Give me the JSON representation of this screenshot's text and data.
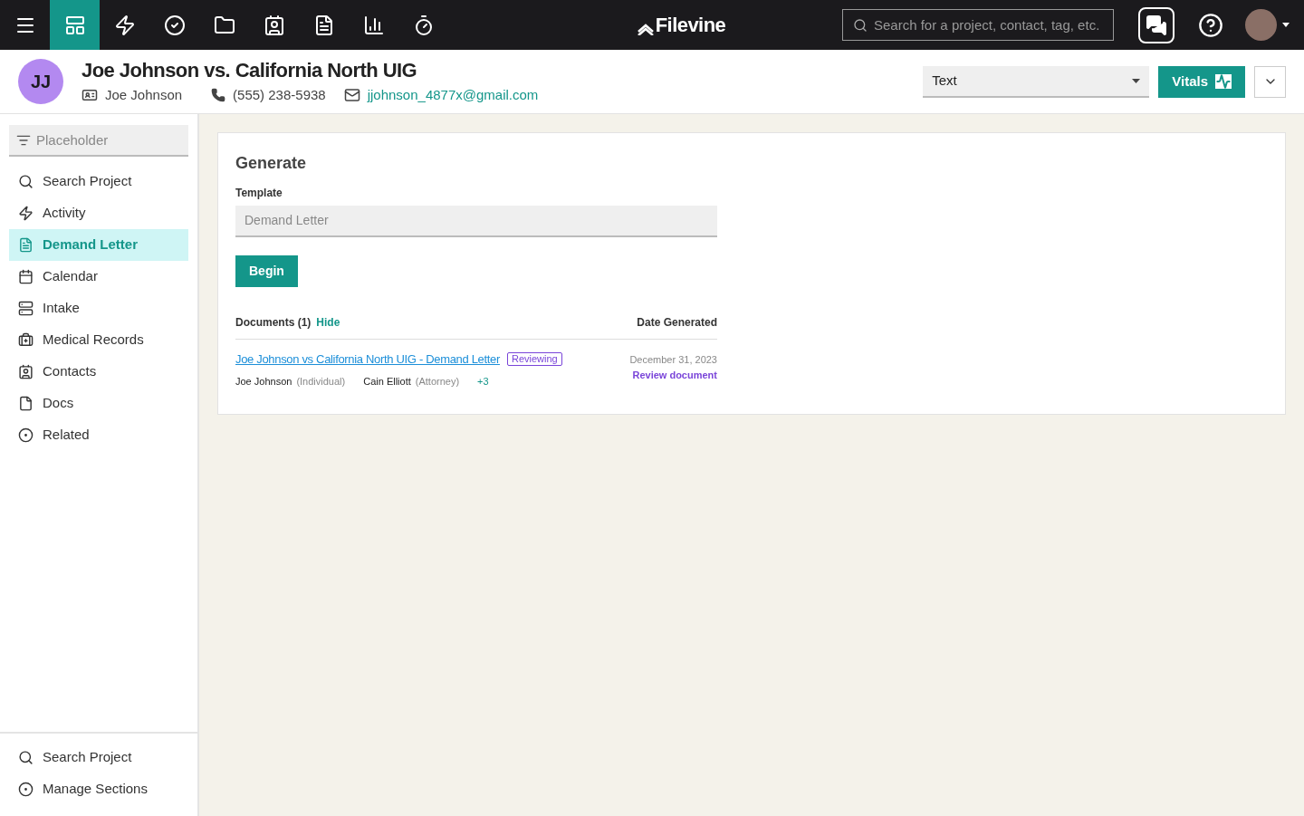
{
  "topbar": {
    "nav": [
      {
        "kind": "menu",
        "selected": false
      },
      {
        "kind": "dashboard",
        "selected": true
      },
      {
        "kind": "bolt",
        "selected": false
      },
      {
        "kind": "check",
        "selected": false
      },
      {
        "kind": "folder",
        "selected": false
      },
      {
        "kind": "contact",
        "selected": false
      },
      {
        "kind": "invoice",
        "selected": false
      },
      {
        "kind": "chart",
        "selected": false
      },
      {
        "kind": "timer",
        "selected": false
      }
    ],
    "logo": "Filevine",
    "search": {
      "placeholder": "Search for a project, contact, tag, etc."
    }
  },
  "header": {
    "initials": "JJ",
    "title": "Joe Johnson vs. California North UIG",
    "client": "Joe Johnson",
    "phone": "(555) 238-5938",
    "email": "jjohnson_4877x@gmail.com",
    "select": "Text",
    "vitals": "Vitals"
  },
  "sidebar": {
    "filter": {
      "placeholder": "Placeholder"
    },
    "items": [
      {
        "label": "Search Project",
        "kind": "search",
        "selected": false
      },
      {
        "label": "Activity",
        "kind": "bolt",
        "selected": false
      },
      {
        "label": "Demand Letter",
        "kind": "invoice",
        "selected": true
      },
      {
        "label": "Calendar",
        "kind": "calendar",
        "selected": false
      },
      {
        "label": "Intake",
        "kind": "intake",
        "selected": false
      },
      {
        "label": "Medical Records",
        "kind": "medical",
        "selected": false
      },
      {
        "label": "Contacts",
        "kind": "contact",
        "selected": false
      },
      {
        "label": "Docs",
        "kind": "doc",
        "selected": false
      },
      {
        "label": "Related",
        "kind": "related",
        "selected": false
      }
    ],
    "footer": [
      {
        "label": "Search Project",
        "kind": "search"
      },
      {
        "label": "Manage Sections",
        "kind": "related"
      }
    ]
  },
  "generate": {
    "title": "Generate",
    "template_label": "Template",
    "template_value": "Demand Letter",
    "begin": "Begin",
    "documents_label": "Documents (1)",
    "hide": "Hide",
    "date_header": "Date Generated",
    "documents": [
      {
        "title": "Joe Johnson vs California North UIG - Demand Letter",
        "status": "Reviewing",
        "date": "December 31, 2023",
        "action": "Review document",
        "people": [
          {
            "name": "Joe Johnson",
            "role": "(Individual)"
          },
          {
            "name": "Cain Elliott",
            "role": "(Attorney)"
          }
        ],
        "more": "+3"
      }
    ]
  }
}
